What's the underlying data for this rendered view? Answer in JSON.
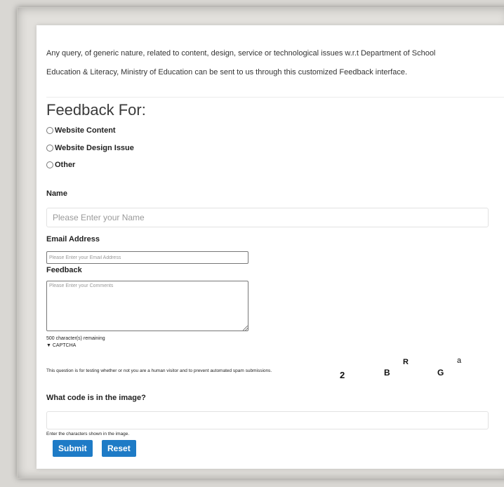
{
  "intro": {
    "line1": "Any query, of generic nature, related to content, design, service or technological issues w.r.t Department of School",
    "line2": "Education & Literacy, Ministry of Education can be sent to us through this customized Feedback interface."
  },
  "feedback_for": {
    "heading": "Feedback For:",
    "options": [
      {
        "label": "Website Content",
        "selected": false
      },
      {
        "label": "Website Design Issue",
        "selected": false
      },
      {
        "label": "Other",
        "selected": false
      }
    ]
  },
  "name": {
    "label": "Name",
    "placeholder": "Please Enter your Name",
    "value": ""
  },
  "email": {
    "label": "Email Address",
    "placeholder": "Please Enter your Email Address",
    "value": ""
  },
  "feedback": {
    "label": "Feedback",
    "placeholder": "Please Enter your Comments",
    "value": "",
    "remaining": "500 character(s) remaining"
  },
  "captcha": {
    "toggle": "▼ CAPTCHA",
    "description": "This question is for testing whether or not you are a human visitor and to prevent automated spam submissions.",
    "chars": [
      "2",
      "B",
      "R",
      "G",
      "a"
    ],
    "question": "What code is in the image?",
    "hint": "Enter the characters shown in the image.",
    "value": ""
  },
  "buttons": {
    "submit": "Submit",
    "reset": "Reset"
  },
  "colors": {
    "button": "#1e7bc6",
    "background": "#d9d7d3"
  }
}
